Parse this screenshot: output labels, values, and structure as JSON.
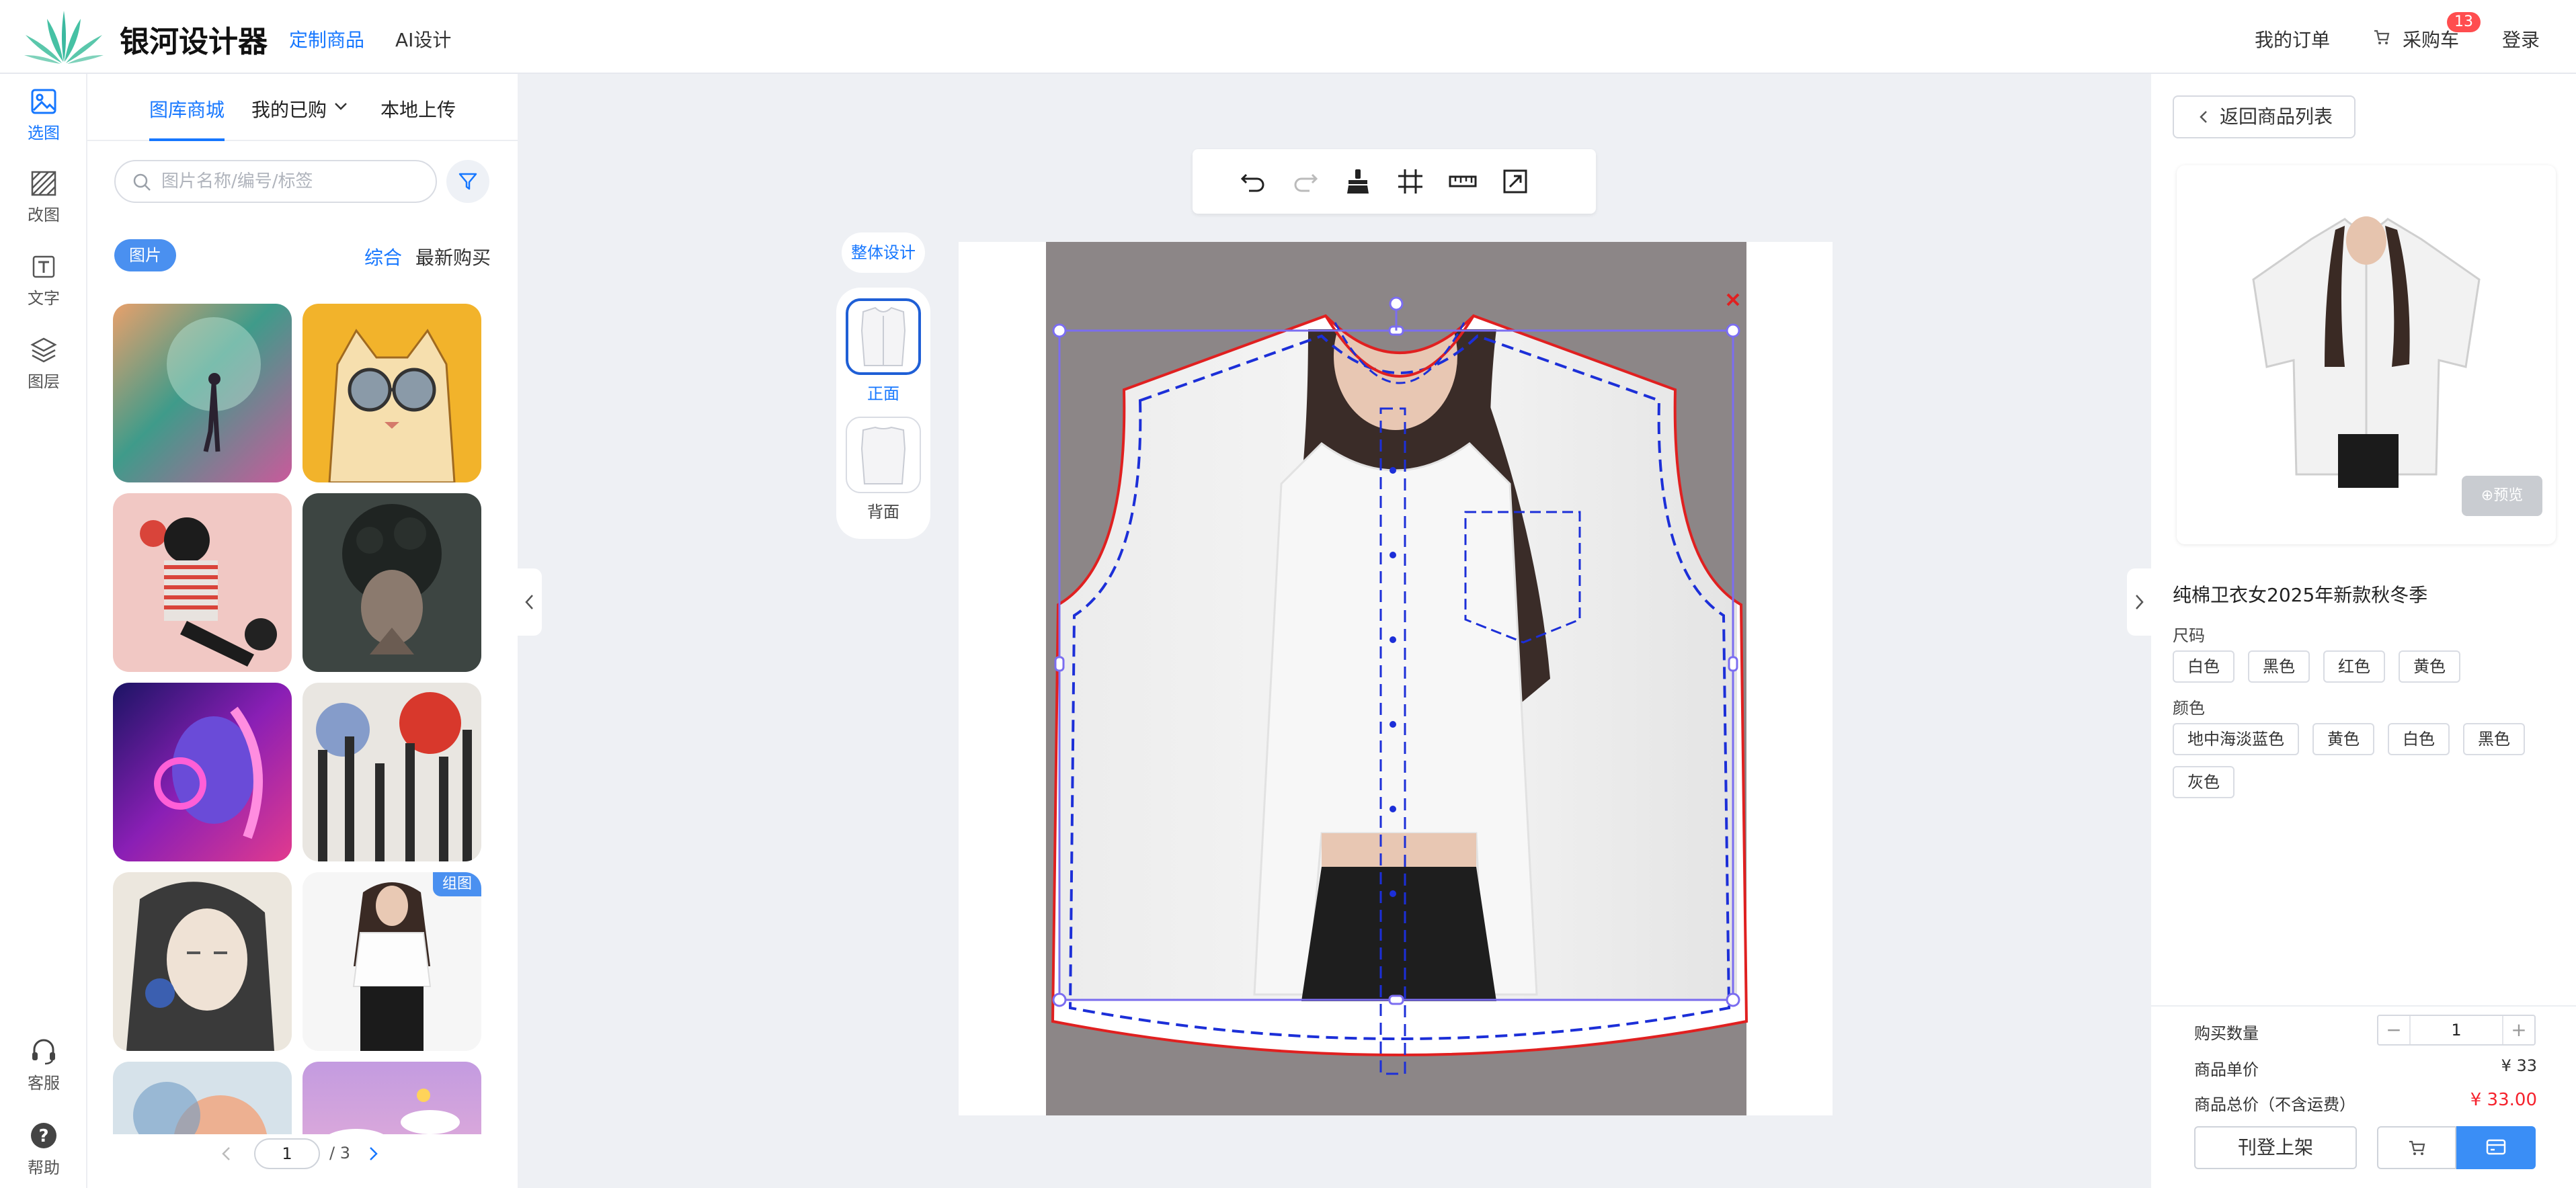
{
  "app": {
    "brand": "银河设计器",
    "nav": [
      "定制商品",
      "AI设计"
    ],
    "right_nav": {
      "orders": "我的订单",
      "cart": "采购车",
      "cart_count": "13",
      "login": "登录"
    }
  },
  "rail": {
    "items": [
      {
        "label": "选图",
        "icon": "image-icon"
      },
      {
        "label": "改图",
        "icon": "hatch-icon"
      },
      {
        "label": "文字",
        "icon": "text-icon"
      },
      {
        "label": "图层",
        "icon": "layers-icon"
      }
    ],
    "bottom": [
      {
        "label": "客服",
        "icon": "headset-icon"
      },
      {
        "label": "帮助",
        "icon": "help-icon"
      }
    ]
  },
  "library": {
    "tabs": [
      "图库商城",
      "我的已购",
      "本地上传"
    ],
    "search_placeholder": "图片名称/编号/标签",
    "chip": "图片",
    "sort": [
      "综合",
      "最新购买"
    ],
    "thumb_tag": "组图",
    "pager": {
      "current": "1",
      "total": "/ 3"
    }
  },
  "editor": {
    "whole_design": "整体设计",
    "views": [
      {
        "label": "正面"
      },
      {
        "label": "背面"
      }
    ]
  },
  "product": {
    "back": "返回商品列表",
    "preview": "预览",
    "title": "纯棉卫衣女2025年新款秋冬季",
    "size_label": "尺码",
    "sizes": [
      "白色",
      "黑色",
      "红色",
      "黄色"
    ],
    "color_label": "颜色",
    "colors": [
      "地中海淡蓝色",
      "黄色",
      "白色",
      "黑色",
      "灰色"
    ],
    "qty_label": "购买数量",
    "qty": "1",
    "unit_price_label": "商品单价",
    "unit_price": "¥ 33",
    "total_label": "商品总价（不含运费）",
    "total": "¥ 33.00",
    "list_button": "刊登上架"
  },
  "colors": {
    "accent": "#1677ff",
    "danger": "#f5222d",
    "badge": "#ff4d4f"
  }
}
